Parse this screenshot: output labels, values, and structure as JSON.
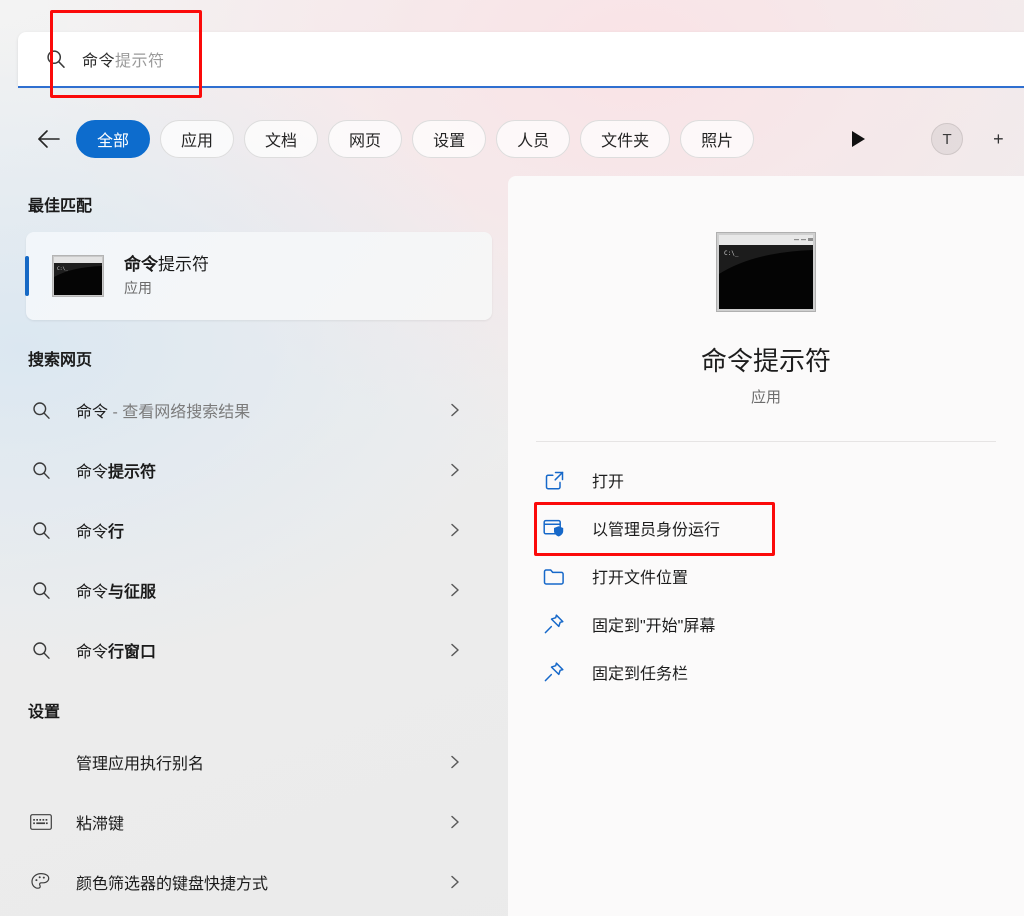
{
  "search": {
    "icon": "search-icon",
    "typed_text": "命令",
    "ghost_text": "提示符",
    "full_query": "命令提示符"
  },
  "filters": {
    "back_icon": "back-arrow-icon",
    "tabs": [
      {
        "label": "全部",
        "selected": true
      },
      {
        "label": "应用",
        "selected": false
      },
      {
        "label": "文档",
        "selected": false
      },
      {
        "label": "网页",
        "selected": false
      },
      {
        "label": "设置",
        "selected": false
      },
      {
        "label": "人员",
        "selected": false
      },
      {
        "label": "文件夹",
        "selected": false
      },
      {
        "label": "照片",
        "selected": false
      }
    ],
    "overflow_icon": "play-triangle-icon",
    "avatar_initial": "T",
    "edge_glyph": "+"
  },
  "left_panel": {
    "best_match": {
      "heading": "最佳匹配",
      "icon": "command-prompt-icon",
      "title_match": "命令",
      "title_rest": "提示符",
      "subtitle": "应用"
    },
    "web_search": {
      "heading": "搜索网页",
      "items": [
        {
          "icon": "search-icon",
          "match": "命令",
          "rest": "",
          "suffix": " - 查看网络搜索结果",
          "chevron": "chevron-right-icon"
        },
        {
          "icon": "search-icon",
          "match": "命令",
          "rest": "提示符",
          "suffix": "",
          "chevron": "chevron-right-icon"
        },
        {
          "icon": "search-icon",
          "match": "命令",
          "rest": "行",
          "suffix": "",
          "chevron": "chevron-right-icon"
        },
        {
          "icon": "search-icon",
          "match": "命令",
          "rest": "与征服",
          "suffix": "",
          "chevron": "chevron-right-icon"
        },
        {
          "icon": "search-icon",
          "match": "命令",
          "rest": "行窗口",
          "suffix": "",
          "chevron": "chevron-right-icon"
        }
      ]
    },
    "settings": {
      "heading": "设置",
      "items": [
        {
          "icon": "none",
          "label": "管理应用执行别名",
          "chevron": "chevron-right-icon"
        },
        {
          "icon": "keyboard-icon",
          "label": "粘滞键",
          "chevron": "chevron-right-icon"
        },
        {
          "icon": "palette-icon",
          "label": "颜色筛选器的键盘快捷方式",
          "chevron": "chevron-right-icon"
        }
      ]
    }
  },
  "right_panel": {
    "app_icon": "command-prompt-icon",
    "app_name": "命令提示符",
    "app_kind": "应用",
    "actions": [
      {
        "icon": "open-external-icon",
        "label": "打开",
        "highlighted": false
      },
      {
        "icon": "run-as-admin-shield-icon",
        "label": "以管理员身份运行",
        "highlighted": true
      },
      {
        "icon": "folder-icon",
        "label": "打开文件位置",
        "highlighted": false
      },
      {
        "icon": "pin-icon",
        "label": "固定到\"开始\"屏幕",
        "highlighted": false
      },
      {
        "icon": "pin-icon",
        "label": "固定到任务栏",
        "highlighted": false
      }
    ]
  },
  "annotations": {
    "highlight_color": "#fb0a0a",
    "boxes": [
      "search-input-box",
      "run-as-admin-action"
    ]
  },
  "colors": {
    "accent_blue": "#0d6ccd",
    "selected_chip": "#0d6ccd",
    "underline_blue": "#2f6fd0",
    "icon_blue": "#1668c9",
    "red_highlight": "#fb0a0a"
  }
}
